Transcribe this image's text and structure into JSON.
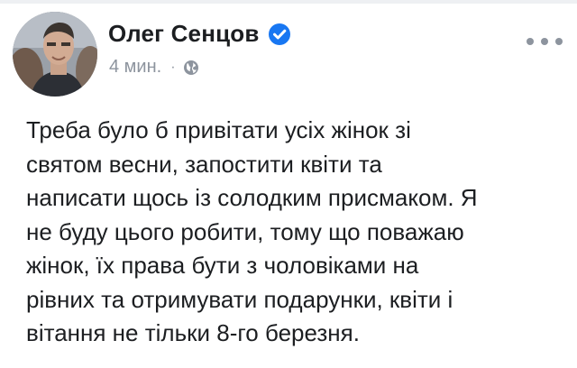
{
  "post": {
    "author": "Олег Сенцов",
    "verified": true,
    "timestamp": "4 мин.",
    "separator": "·",
    "privacy_icon": "globe-icon",
    "more_icon": "more-options-icon",
    "text": "Треба було б привітати усіх жінок зі\nсвятом весни, запостити квіти та\nнаписати щось із солодким присмаком. Я\nне буду цього робити, тому що поважаю\nжінок, їх права бути з чоловіками на\nрівних та отримувати подарунки, квіти і\nвітання не тільки 8-го березня."
  },
  "colors": {
    "verified_badge": "#1877f2",
    "meta_text": "#8d949e",
    "body_text": "#1c1e21"
  }
}
